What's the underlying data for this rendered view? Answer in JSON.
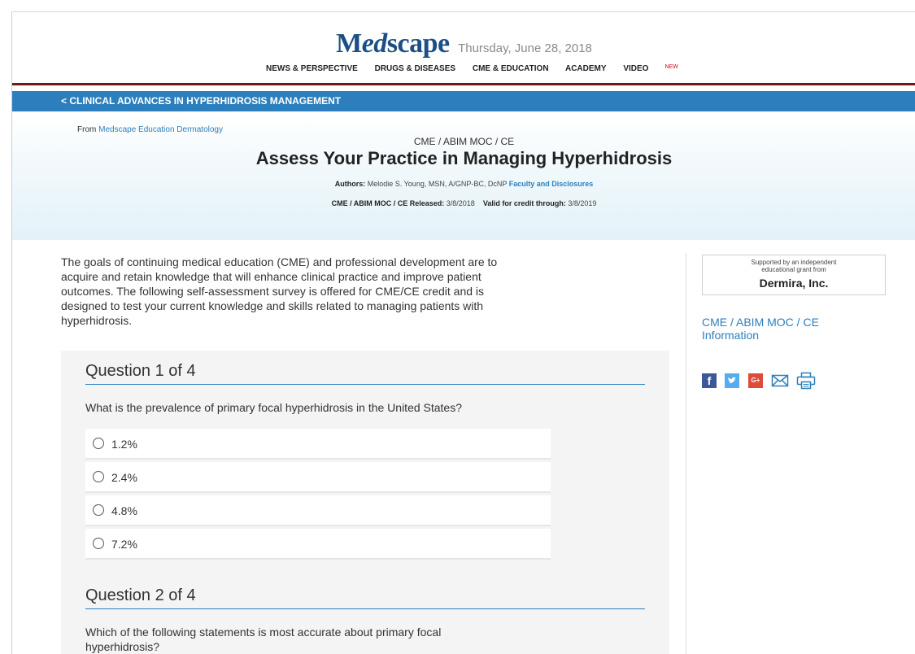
{
  "header": {
    "logo": "Medscape",
    "date": "Thursday, June 28, 2018",
    "nav": [
      "NEWS & PERSPECTIVE",
      "DRUGS & DISEASES",
      "CME & EDUCATION",
      "ACADEMY",
      "VIDEO"
    ],
    "nav_badge": "NEW"
  },
  "breadcrumb": "< CLINICAL ADVANCES IN HYPERHIDROSIS MANAGEMENT",
  "article": {
    "from_prefix": "From",
    "from_source": "Medscape Education Dermatology",
    "cme_label": "CME / ABIM MOC / CE",
    "title": "Assess Your Practice in Managing Hyperhidrosis",
    "authors_label": "Authors:",
    "authors": "Melodie S. Young, MSN, A/GNP-BC, DcNP",
    "faculty_link": "Faculty and Disclosures",
    "released_label": "CME / ABIM MOC / CE Released:",
    "released_date": "3/8/2018",
    "valid_label": "Valid for credit through:",
    "valid_date": "3/8/2019"
  },
  "intro": "The goals of continuing medical education (CME) and professional development are to acquire and retain knowledge that will enhance clinical practice and improve patient outcomes. The following self-assessment survey is offered for CME/CE credit and is designed to test your current knowledge and skills related to managing patients with hyperhidrosis.",
  "questions": [
    {
      "header": "Question 1 of 4",
      "text": "What is the prevalence of primary focal hyperhidrosis in the United States?",
      "options": [
        "1.2%",
        "2.4%",
        "4.8%",
        "7.2%"
      ]
    },
    {
      "header": "Question 2 of 4",
      "text": "Which of the following statements is most accurate about primary focal hyperhidrosis?"
    }
  ],
  "sidebar": {
    "sponsor_line1": "Supported by an independent",
    "sponsor_line2": "educational grant from",
    "sponsor_name": "Dermira, Inc.",
    "cme_info_link": "CME / ABIM MOC / CE Information",
    "social": [
      "facebook-icon",
      "twitter-icon",
      "google-plus-icon",
      "email-icon",
      "print-icon"
    ]
  },
  "colors": {
    "brand_blue": "#2c7fbc",
    "logo_blue": "#1b4f86",
    "rule_maroon": "#6f1b1b"
  }
}
